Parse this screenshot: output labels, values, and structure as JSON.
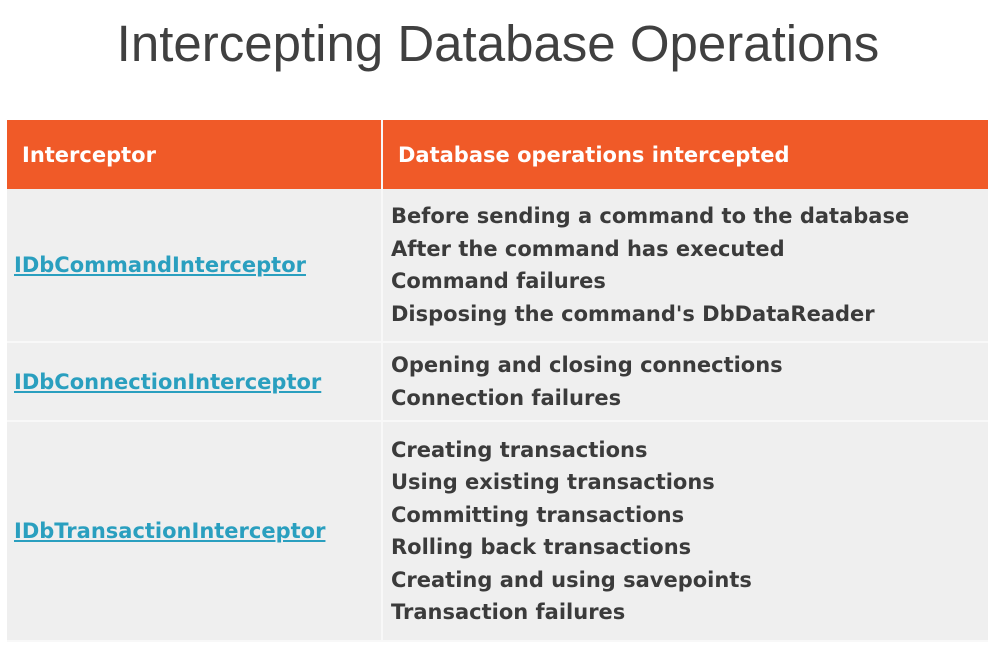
{
  "title": "Intercepting Database Operations",
  "table": {
    "headers": [
      "Interceptor",
      "Database operations intercepted"
    ],
    "rows": [
      {
        "interceptor": "IDbCommandInterceptor",
        "operations": [
          "Before sending a command to the database",
          "After the command has executed",
          "Command failures",
          "Disposing the command's DbDataReader"
        ]
      },
      {
        "interceptor": "IDbConnectionInterceptor",
        "operations": [
          "Opening and closing connections",
          "Connection failures"
        ]
      },
      {
        "interceptor": "IDbTransactionInterceptor",
        "operations": [
          "Creating transactions",
          "Using existing transactions",
          "Committing transactions",
          "Rolling back transactions",
          "Creating and using savepoints",
          "Transaction failures"
        ]
      }
    ]
  },
  "colors": {
    "header_bg": "#f05a28",
    "link": "#2a9fbf",
    "row_bg": "#efefef",
    "text": "#3b3b3b"
  }
}
